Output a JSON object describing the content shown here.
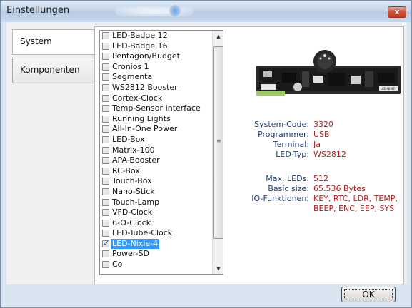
{
  "window": {
    "title": "Einstellungen",
    "close_glyph": "x"
  },
  "tabs": [
    {
      "label": "System"
    },
    {
      "label": "Komponenten"
    }
  ],
  "components": [
    {
      "label": "LED-Badge 12",
      "checked": false
    },
    {
      "label": "LED-Badge 16",
      "checked": false
    },
    {
      "label": "Pentagon/Budget",
      "checked": false
    },
    {
      "label": "Cronios 1",
      "checked": false
    },
    {
      "label": "Segmenta",
      "checked": false
    },
    {
      "label": "WS2812 Booster",
      "checked": false
    },
    {
      "label": "Cortex-Clock",
      "checked": false
    },
    {
      "label": "Temp-Sensor Interface",
      "checked": false
    },
    {
      "label": "Running Lights",
      "checked": false
    },
    {
      "label": "All-In-One Power",
      "checked": false
    },
    {
      "label": "LED-Box",
      "checked": false
    },
    {
      "label": "Matrix-100",
      "checked": false
    },
    {
      "label": "APA-Booster",
      "checked": false
    },
    {
      "label": "RC-Box",
      "checked": false
    },
    {
      "label": "Touch-Box",
      "checked": false
    },
    {
      "label": "Nano-Stick",
      "checked": false
    },
    {
      "label": "Touch-Lamp",
      "checked": false
    },
    {
      "label": "VFD-Clock",
      "checked": false
    },
    {
      "label": "6-O-Clock",
      "checked": false
    },
    {
      "label": "LED-Tube-Clock",
      "checked": false
    },
    {
      "label": "LED-Nixie-4",
      "checked": true,
      "selected": true
    },
    {
      "label": "Power-SD",
      "checked": false
    },
    {
      "label": "Co",
      "checked": false
    }
  ],
  "scrollbar": {
    "up": "▲",
    "down": "▼",
    "grip": "≡"
  },
  "details": {
    "system_code": {
      "key": "System-Code:",
      "value": "3320"
    },
    "programmer": {
      "key": "Programmer:",
      "value": "USB"
    },
    "terminal": {
      "key": "Terminal:",
      "value": "Ja"
    },
    "led_typ": {
      "key": "LED-Typ:",
      "value": "WS2812"
    },
    "max_leds": {
      "key": "Max. LEDs:",
      "value": "512"
    },
    "basic_size": {
      "key": "Basic size:",
      "value": "65.536 Bytes"
    },
    "io_funktionen": {
      "key": "IO-Funktionen:",
      "value_line1": "KEY, RTC, LDR, TEMP,",
      "value_line2": "BEEP, ENC, EEP, SYS"
    }
  },
  "board_label": "LED-NIXIE",
  "ok_button": {
    "label": "OK"
  }
}
